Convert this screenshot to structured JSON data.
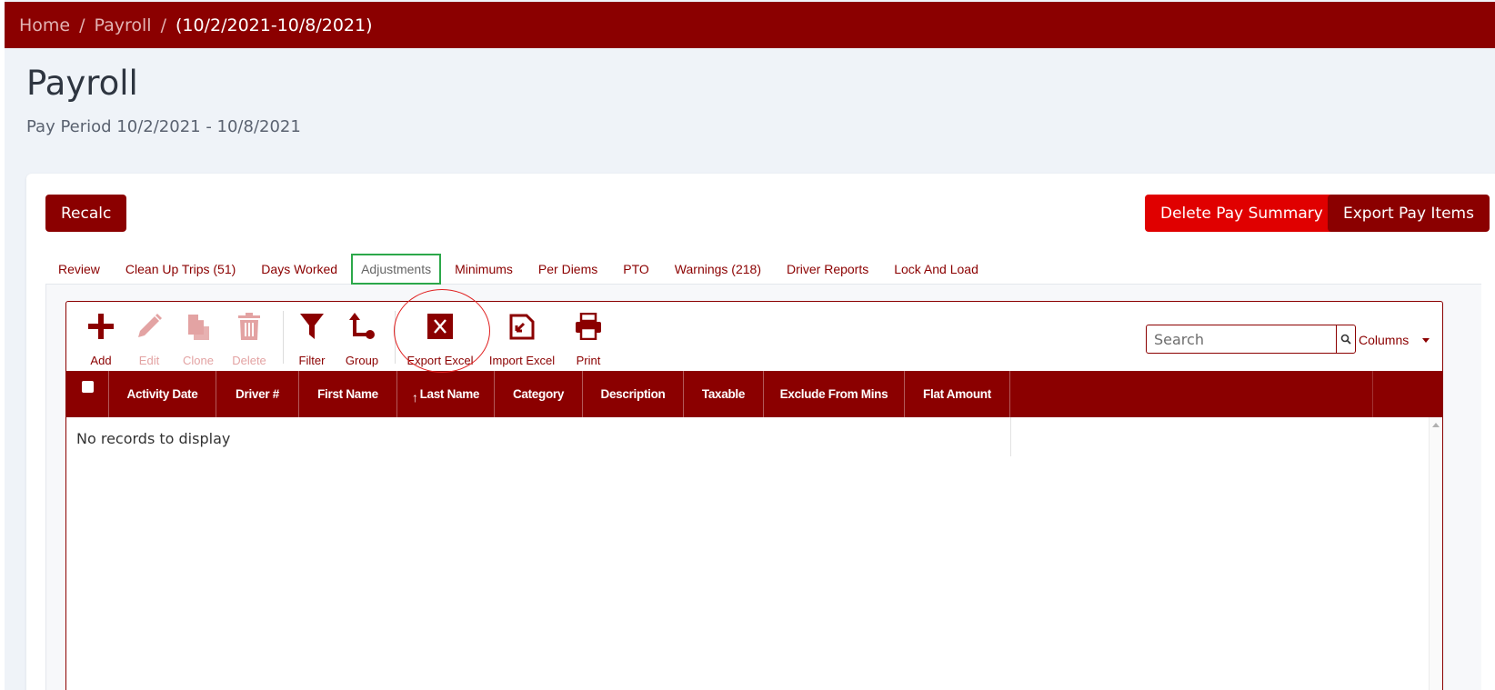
{
  "breadcrumb": {
    "home": "Home",
    "payroll": "Payroll",
    "separator": "/",
    "current": "(10/2/2021-10/8/2021)"
  },
  "page": {
    "title": "Payroll",
    "subtitle": "Pay Period 10/2/2021 - 10/8/2021"
  },
  "actions": {
    "recalc": "Recalc",
    "delete_pay_summary": "Delete Pay Summary",
    "export_pay_items": "Export Pay Items"
  },
  "tabs": [
    {
      "label": "Review",
      "active": false
    },
    {
      "label": "Clean Up Trips (51)",
      "active": false
    },
    {
      "label": "Days Worked",
      "active": false
    },
    {
      "label": "Adjustments",
      "active": true
    },
    {
      "label": "Minimums",
      "active": false
    },
    {
      "label": "Per Diems",
      "active": false
    },
    {
      "label": "PTO",
      "active": false
    },
    {
      "label": "Warnings (218)",
      "active": false
    },
    {
      "label": "Driver Reports",
      "active": false
    },
    {
      "label": "Lock And Load",
      "active": false
    }
  ],
  "toolbar": {
    "add": "Add",
    "edit": "Edit",
    "clone": "Clone",
    "delete": "Delete",
    "filter": "Filter",
    "group": "Group",
    "export_excel": "Export Excel",
    "import_excel": "Import Excel",
    "print": "Print"
  },
  "search": {
    "placeholder": "Search",
    "value": ""
  },
  "columns_label": "Columns",
  "table": {
    "headers": [
      "Activity Date",
      "Driver #",
      "First Name",
      "Last Name",
      "Category",
      "Description",
      "Taxable",
      "Exclude From Mins",
      "Flat Amount"
    ],
    "sorted_column": "Last Name",
    "empty_message": "No records to display"
  },
  "colors": {
    "brand": "#8b0000",
    "danger": "#e00000",
    "active_tab_border": "#2ca84a",
    "annotation": "#e02020"
  }
}
